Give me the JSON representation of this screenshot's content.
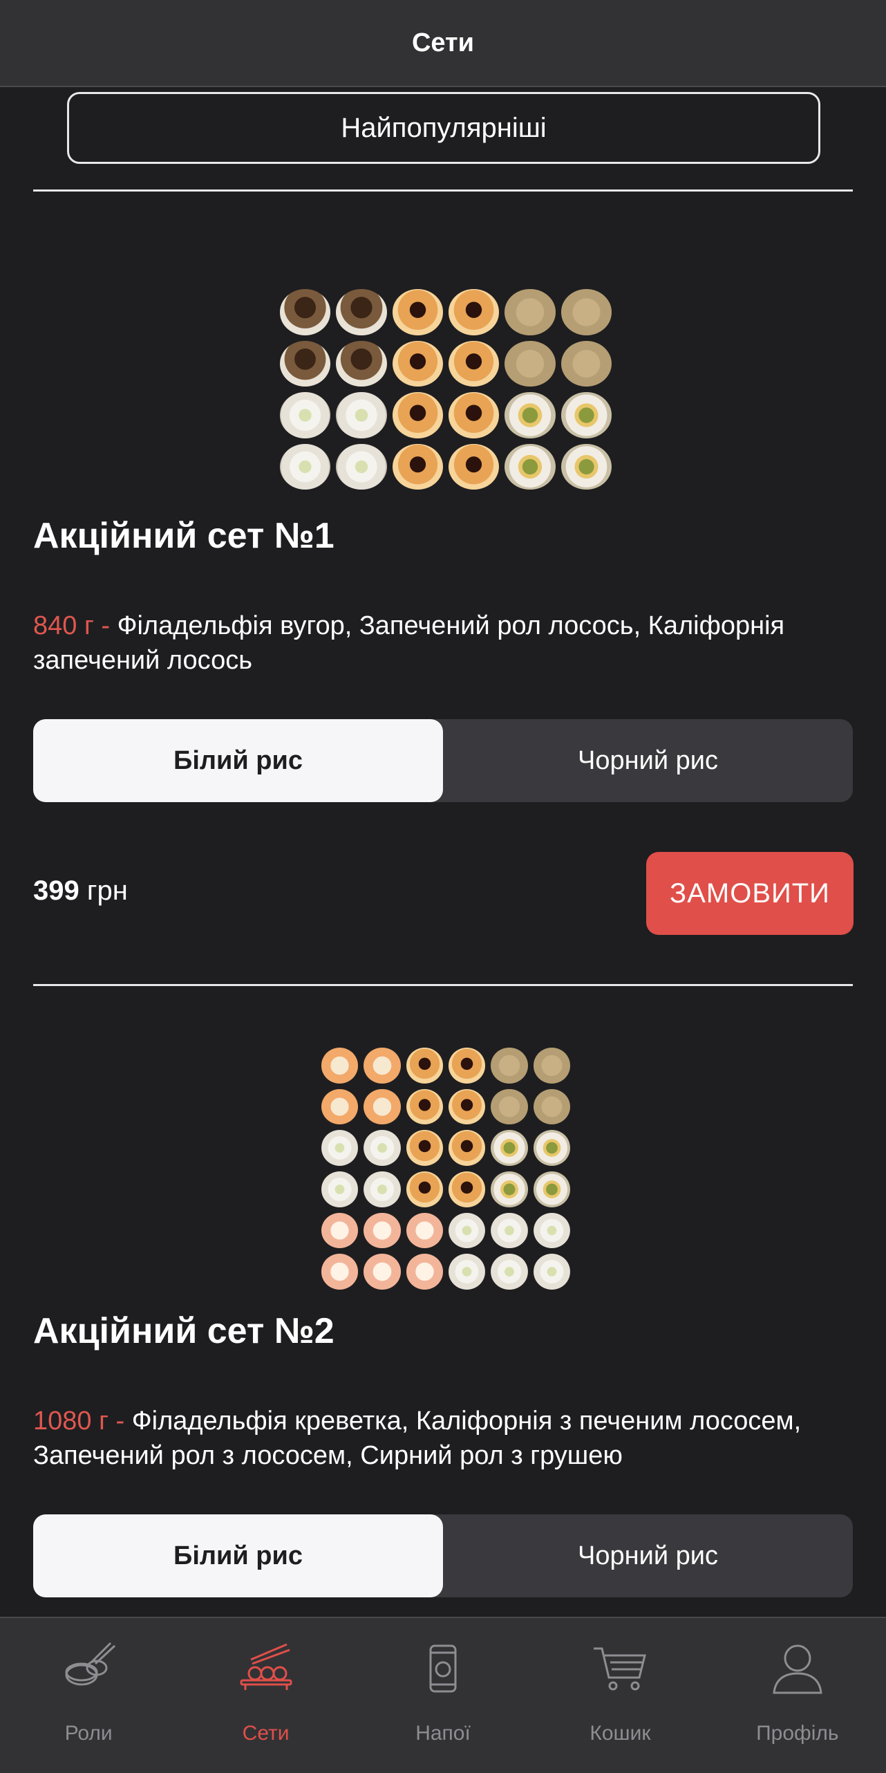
{
  "header": {
    "title": "Сети"
  },
  "sort": {
    "label": "Найпопулярніші"
  },
  "products": [
    {
      "title": "Акційний сет №1",
      "weight": "840 г - ",
      "description": "Філадельфія вугор, Запечений рол лосось, Каліфорнія запечений лосось",
      "rice_options": [
        "Білий рис",
        "Чорний рис"
      ],
      "selected_rice": "Білий рис",
      "price_value": "399",
      "price_currency": " грн",
      "order_label": "ЗАМОВИТИ"
    },
    {
      "title": "Акційний сет №2",
      "weight": "1080 г - ",
      "description": "Філадельфія креветка, Каліфорнія з печеним лососем, Запечений рол з лососем, Сирний рол з грушею",
      "rice_options": [
        "Білий рис",
        "Чорний рис"
      ],
      "selected_rice": "Білий рис"
    }
  ],
  "bottom_nav": {
    "items": [
      {
        "label": "Роли",
        "icon": "rolls-icon",
        "active": false
      },
      {
        "label": "Сети",
        "icon": "sets-icon",
        "active": true
      },
      {
        "label": "Напої",
        "icon": "drinks-icon",
        "active": false
      },
      {
        "label": "Кошик",
        "icon": "cart-icon",
        "active": false
      },
      {
        "label": "Профіль",
        "icon": "profile-icon",
        "active": false
      }
    ]
  },
  "colors": {
    "accent": "#e04f49",
    "background": "#1e1e20",
    "bar": "#323235",
    "nav_inactive": "#8d8d92"
  }
}
